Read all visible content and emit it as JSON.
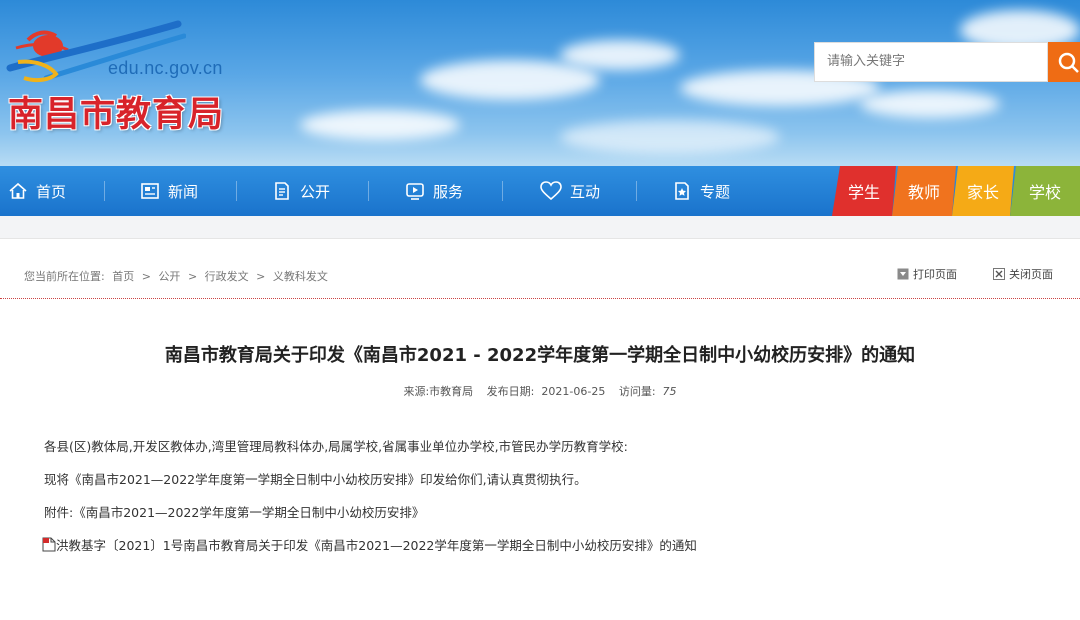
{
  "header": {
    "domain": "edu.nc.gov.cn",
    "site_name": "南昌市教育局",
    "search_placeholder": "请输入关键字",
    "accent": "#ef6c14"
  },
  "nav": {
    "items": [
      {
        "label": "首页",
        "icon": "home-icon"
      },
      {
        "label": "新闻",
        "icon": "news-icon"
      },
      {
        "label": "公开",
        "icon": "document-icon"
      },
      {
        "label": "服务",
        "icon": "service-icon"
      },
      {
        "label": "互动",
        "icon": "heart-icon"
      },
      {
        "label": "专题",
        "icon": "topic-icon"
      }
    ],
    "tabs": [
      {
        "label": "学生",
        "color": "#e0302d"
      },
      {
        "label": "教师",
        "color": "#f0731e"
      },
      {
        "label": "家长",
        "color": "#f5aa16"
      },
      {
        "label": "学校",
        "color": "#8cb43a"
      }
    ]
  },
  "breadcrumb": {
    "prefix": "您当前所在位置:",
    "items": [
      "首页",
      "公开",
      "行政发文",
      "义教科发文"
    ],
    "separator": ">"
  },
  "page_actions": {
    "print": "打印页面",
    "close": "关闭页面"
  },
  "article": {
    "title": "南昌市教育局关于印发《南昌市2021 - 2022学年度第一学期全日制中小幼校历安排》的通知",
    "source_label": "来源:",
    "source": "市教育局",
    "date_label": "发布日期:",
    "date": "2021-06-25",
    "views_label": "访问量:",
    "views": "75",
    "paragraphs": [
      "各县(区)教体局,开发区教体办,湾里管理局教科体办,局属学校,省属事业单位办学校,市管民办学历教育学校:",
      "现将《南昌市2021—2022学年度第一学期全日制中小幼校历安排》印发给你们,请认真贯彻执行。",
      "附件:《南昌市2021—2022学年度第一学期全日制中小幼校历安排》"
    ],
    "attachment": "洪教基字〔2021〕1号南昌市教育局关于印发《南昌市2021—2022学年度第一学期全日制中小幼校历安排》的通知"
  }
}
